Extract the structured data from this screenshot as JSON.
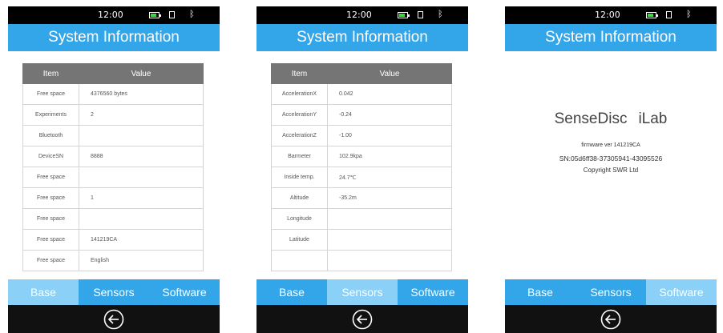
{
  "status": {
    "time": "12:00"
  },
  "title": "System Information",
  "tabs": [
    "Base",
    "Sensors",
    "Software"
  ],
  "icons": {
    "battery": "battery-icon",
    "screen": "screen-icon",
    "bluetooth": "bluetooth-icon",
    "back": "back-arrow-icon"
  },
  "colors": {
    "header": "#33a5e9",
    "active_tab": "#8ad0f7",
    "table_header": "#757575",
    "nav_bar": "#111111",
    "battery_fill": "#43d24a"
  },
  "screens": [
    {
      "active_tab": "Base",
      "columns": [
        "Item",
        "Value"
      ],
      "rows": [
        [
          "Free space",
          "4376560 bytes"
        ],
        [
          "Experiments",
          "2"
        ],
        [
          "Bluetooth",
          ""
        ],
        [
          "DeviceSN",
          "8888"
        ],
        [
          "Free space",
          ""
        ],
        [
          "Free space",
          "1"
        ],
        [
          "Free space",
          ""
        ],
        [
          "Free space",
          "141219CA"
        ],
        [
          "Free space",
          "English"
        ]
      ]
    },
    {
      "active_tab": "Sensors",
      "columns": [
        "Item",
        "Value"
      ],
      "rows": [
        [
          "AccelerationX",
          "0.042"
        ],
        [
          "AccelerationY",
          "-0.24"
        ],
        [
          "AccelerationZ",
          "-1.00"
        ],
        [
          "Barmeter",
          "102.9kpa"
        ],
        [
          "Inside temp.",
          "24.7℃"
        ],
        [
          "Altitude",
          "-35.2m"
        ],
        [
          "Longitude",
          ""
        ],
        [
          "Latitude",
          ""
        ],
        [
          "",
          ""
        ]
      ]
    },
    {
      "active_tab": "Software",
      "product": "SenseDisc",
      "product_suffix": "iLab",
      "firmware": "firmware ver 141219CA",
      "serial": "SN:05d6ff38-37305941-43095526",
      "copyright": "Copyright SWR Ltd"
    }
  ]
}
